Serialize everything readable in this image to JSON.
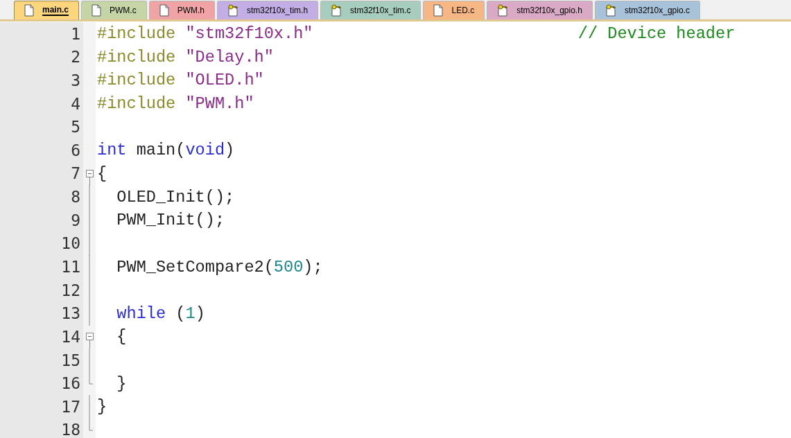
{
  "tabs": [
    {
      "label": "main.c",
      "kind": "file",
      "color": "#fbd67c",
      "selected": true
    },
    {
      "label": "PWM.c",
      "kind": "file",
      "color": "#c6d5a6",
      "selected": false
    },
    {
      "label": "PWM.h",
      "kind": "file",
      "color": "#efa3a5",
      "selected": false
    },
    {
      "label": "stm32f10x_tim.h",
      "kind": "key-file",
      "color": "#c2aee4",
      "selected": false
    },
    {
      "label": "stm32f10x_tim.c",
      "kind": "key-file",
      "color": "#a6cdbd",
      "selected": false
    },
    {
      "label": "LED.c",
      "kind": "file",
      "color": "#f7b784",
      "selected": false
    },
    {
      "label": "stm32f10x_gpio.h",
      "kind": "key-file",
      "color": "#d9a9c5",
      "selected": false
    },
    {
      "label": "stm32f10x_gpio.c",
      "kind": "key-file",
      "color": "#a8c3d9",
      "selected": false
    }
  ],
  "lines": [
    {
      "number": "1",
      "kind": "plain",
      "tokens": [
        {
          "kind": "preproc",
          "text": "#include "
        },
        {
          "kind": "string",
          "text": "\"stm32f10x.h\""
        },
        {
          "kind": "comment",
          "text": "                           // Device header"
        }
      ]
    },
    {
      "number": "2",
      "kind": "plain",
      "tokens": [
        {
          "kind": "preproc",
          "text": "#include "
        },
        {
          "kind": "string",
          "text": "\"Delay.h\""
        }
      ]
    },
    {
      "number": "3",
      "kind": "plain",
      "tokens": [
        {
          "kind": "preproc",
          "text": "#include "
        },
        {
          "kind": "string",
          "text": "\"OLED.h\""
        }
      ]
    },
    {
      "number": "4",
      "kind": "plain",
      "tokens": [
        {
          "kind": "preproc",
          "text": "#include "
        },
        {
          "kind": "string",
          "text": "\"PWM.h\""
        }
      ]
    },
    {
      "number": "5",
      "kind": "plain"
    },
    {
      "number": "6",
      "kind": "plain",
      "tokens": [
        {
          "kind": "keyword",
          "text": "int"
        },
        {
          "kind": "plain",
          "text": " main("
        },
        {
          "kind": "keyword",
          "text": "void"
        },
        {
          "kind": "plain",
          "text": ")"
        }
      ]
    },
    {
      "number": "7",
      "kind": "fold-start",
      "tokens": [
        {
          "kind": "plain",
          "text": "{"
        }
      ]
    },
    {
      "number": "8",
      "kind": "fold-body",
      "tokens": [
        {
          "kind": "plain",
          "text": "  OLED_Init();"
        }
      ]
    },
    {
      "number": "9",
      "kind": "fold-body",
      "tokens": [
        {
          "kind": "plain",
          "text": "  PWM_Init();"
        }
      ]
    },
    {
      "number": "10",
      "kind": "fold-body"
    },
    {
      "number": "11",
      "kind": "fold-body",
      "tokens": [
        {
          "kind": "plain",
          "text": "  PWM_SetCompare2("
        },
        {
          "kind": "number",
          "text": "500"
        },
        {
          "kind": "plain",
          "text": ");"
        }
      ]
    },
    {
      "number": "12",
      "kind": "fold-body"
    },
    {
      "number": "13",
      "kind": "fold-body",
      "tokens": [
        {
          "kind": "keyword",
          "text": "  while"
        },
        {
          "kind": "plain",
          "text": " ("
        },
        {
          "kind": "number",
          "text": "1"
        },
        {
          "kind": "plain",
          "text": ")"
        }
      ]
    },
    {
      "number": "14",
      "kind": "fold-start",
      "tokens": [
        {
          "kind": "plain",
          "text": "  {"
        }
      ]
    },
    {
      "number": "15",
      "kind": "fold-body"
    },
    {
      "number": "16",
      "kind": "fold-end",
      "tokens": [
        {
          "kind": "plain",
          "text": "  }"
        }
      ]
    },
    {
      "number": "17",
      "kind": "fold-body",
      "tokens": [
        {
          "kind": "plain",
          "text": "}"
        }
      ]
    },
    {
      "number": "18",
      "kind": "fold-end"
    }
  ]
}
